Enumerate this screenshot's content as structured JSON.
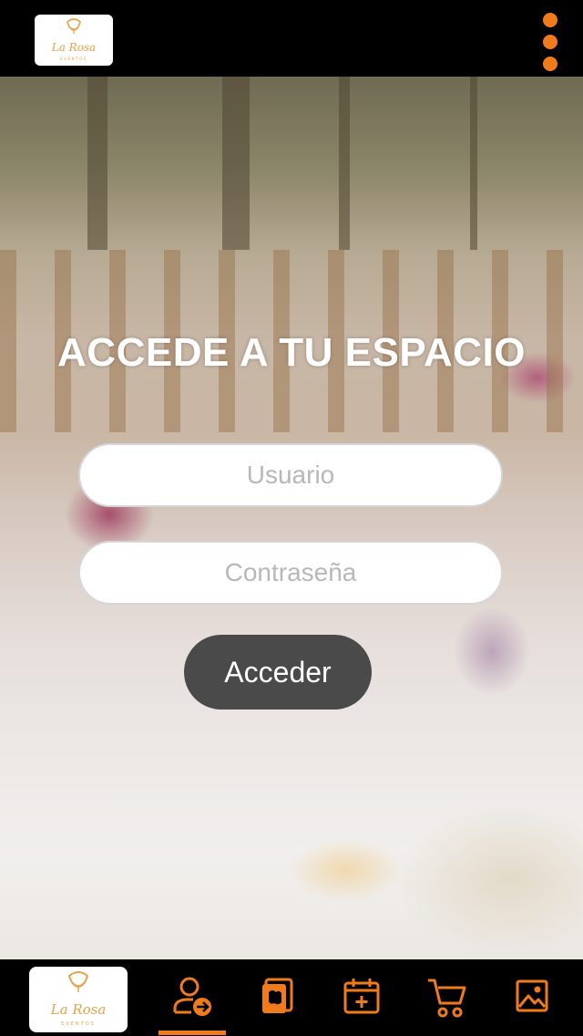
{
  "brand": {
    "logo_text": "La Rosa",
    "logo_subtext": "EVENTOS",
    "accent": "#f07b1c"
  },
  "topbar": {
    "menu_icon": "more-vertical-icon"
  },
  "login": {
    "title": "ACCEDE A TU ESPACIO",
    "username_placeholder": "Usuario",
    "password_placeholder": "Contraseña",
    "submit_label": "Acceder",
    "button_color": "#4a4a4a"
  },
  "bottom_nav": {
    "items": [
      {
        "icon": "logo-home-icon",
        "active": false
      },
      {
        "icon": "user-login-icon",
        "active": true
      },
      {
        "icon": "menu-book-icon",
        "active": false
      },
      {
        "icon": "calendar-add-icon",
        "active": false
      },
      {
        "icon": "shopping-cart-icon",
        "active": false
      },
      {
        "icon": "gallery-image-icon",
        "active": false
      }
    ]
  }
}
